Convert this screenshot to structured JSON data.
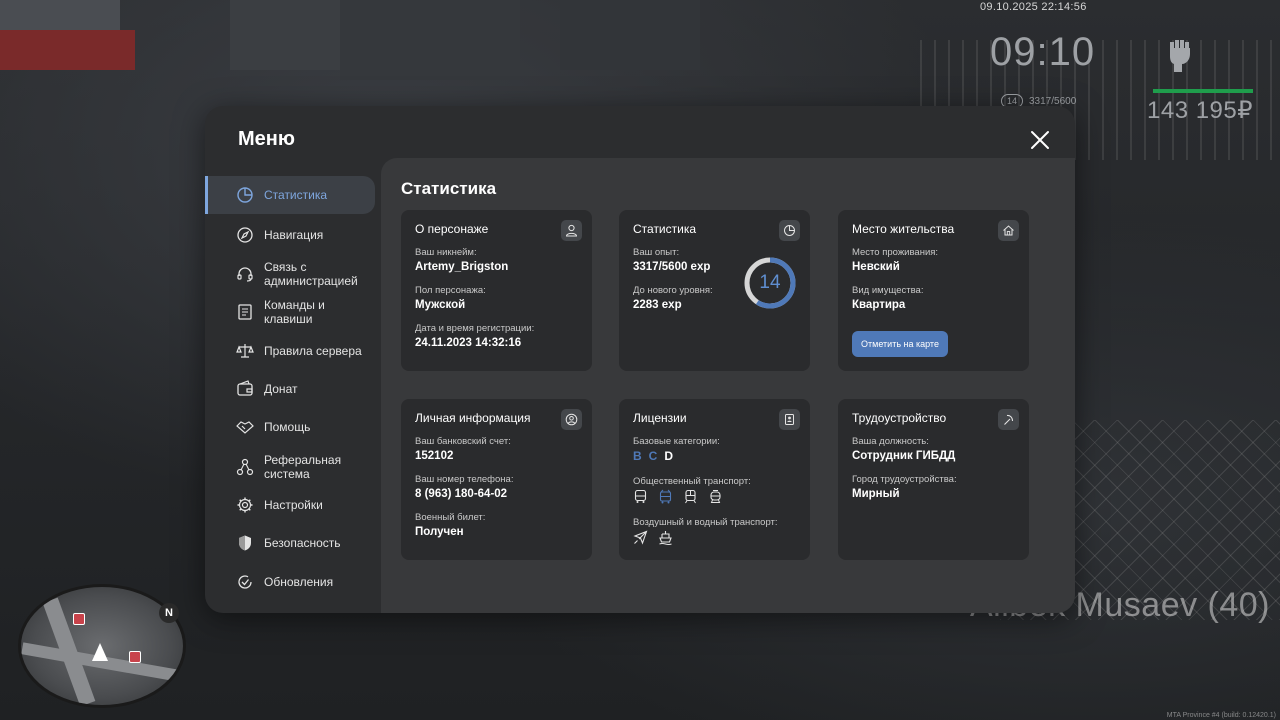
{
  "hud": {
    "datetime": "09.10.2025 22:14:56",
    "clock": "09:10",
    "level": "14",
    "exp": "3317/5600",
    "money": "143 195₽",
    "player_name": "Alibek Musaev (40)",
    "minimap_north": "N",
    "build_info": "MTA Province #4 (build: 0.12420.1)"
  },
  "menu": {
    "title": "Меню",
    "sidebar": [
      {
        "label": "Статистика",
        "icon": "pie-chart-icon",
        "active": true
      },
      {
        "label": "Навигация",
        "icon": "compass-icon"
      },
      {
        "label": "Связь с администрацией",
        "icon": "headset-icon"
      },
      {
        "label": "Команды и клавиши",
        "icon": "document-icon"
      },
      {
        "label": "Правила сервера",
        "icon": "scales-icon"
      },
      {
        "label": "Донат",
        "icon": "wallet-icon"
      },
      {
        "label": "Помощь",
        "icon": "handshake-icon"
      },
      {
        "label": "Реферальная система",
        "icon": "network-icon"
      },
      {
        "label": "Настройки",
        "icon": "gear-icon"
      },
      {
        "label": "Безопасность",
        "icon": "shield-icon"
      },
      {
        "label": "Обновления",
        "icon": "refresh-check-icon"
      }
    ],
    "content_title": "Статистика",
    "character": {
      "title": "О персонаже",
      "nick_label": "Ваш никнейм:",
      "nick": "Artemy_Brigston",
      "gender_label": "Пол персонажа:",
      "gender": "Мужской",
      "reg_label": "Дата и время регистрации:",
      "reg": "24.11.2023 14:32:16"
    },
    "stats": {
      "title": "Статистика",
      "exp_label": "Ваш опыт:",
      "exp": "3317/5600 exp",
      "next_label": "До нового уровня:",
      "next": "2283 exp",
      "level": "14",
      "progress": 0.592
    },
    "residence": {
      "title": "Место жительства",
      "place_label": "Место проживания:",
      "place": "Невский",
      "property_label": "Вид имущества:",
      "property": "Квартира",
      "map_button": "Отметить на карте"
    },
    "personal": {
      "title": "Личная информация",
      "bank_label": "Ваш банковский счет:",
      "bank": "152102",
      "phone_label": "Ваш номер телефона:",
      "phone": "8 (963) 180-64-02",
      "military_label": "Военный билет:",
      "military": "Получен"
    },
    "licenses": {
      "title": "Лицензии",
      "base_label": "Базовые категории:",
      "categories": [
        "B",
        "C",
        "D"
      ],
      "public_label": "Общественный транспорт:",
      "air_label": "Воздушный и водный транспорт:"
    },
    "job": {
      "title": "Трудоустройство",
      "position_label": "Ваша должность:",
      "position": "Сотрудник ГИБДД",
      "city_label": "Город трудоустройства:",
      "city": "Мирный"
    },
    "colors": {
      "accent": "#4f79b8",
      "accent_light": "#7ea6de",
      "window": "#2c2d2f",
      "card": "#2a2b2d"
    }
  }
}
